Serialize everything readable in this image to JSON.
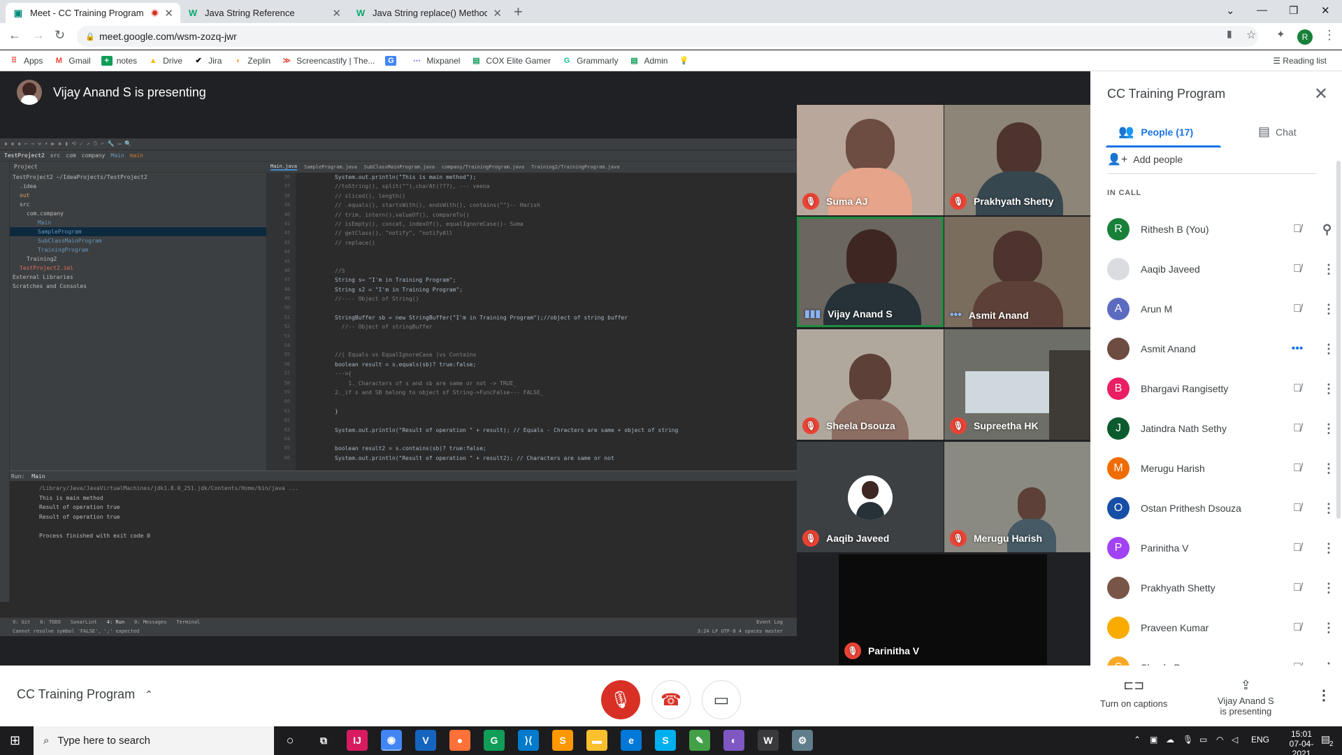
{
  "browser": {
    "tabs": [
      {
        "title": "Meet - CC Training Program"
      },
      {
        "title": "Java String Reference"
      },
      {
        "title": "Java String replace() Method"
      }
    ],
    "url": "meet.google.com/wsm-zozq-jwr",
    "bookmarks": [
      "Apps",
      "Gmail",
      "notes",
      "Drive",
      "Jira",
      "Zeplin",
      "Screencastify | The...",
      "",
      "Mixpanel",
      "COX Elite Gamer",
      "Grammarly",
      "Admin",
      ""
    ],
    "reading_list": "Reading list",
    "profile_letter": "R"
  },
  "meet": {
    "presenting_banner": "Vijay Anand S is presenting",
    "meeting_name": "CC Training Program",
    "tiles": [
      {
        "name": "Suma AJ",
        "muted": true
      },
      {
        "name": "Prakhyath Shetty",
        "muted": true
      },
      {
        "name": "Vijay Anand S",
        "muted": false
      },
      {
        "name": "Asmit Anand",
        "muted": false
      },
      {
        "name": "Sheela Dsouza",
        "muted": true
      },
      {
        "name": "Supreetha HK",
        "muted": true
      },
      {
        "name": "Aaqib Javeed",
        "muted": true
      },
      {
        "name": "Merugu Harish",
        "muted": true
      },
      {
        "name": "Parinitha V",
        "muted": true
      }
    ],
    "captions_label": "Turn on captions",
    "presenting_label_1": "Vijay Anand S",
    "presenting_label_2": "is presenting"
  },
  "side_panel": {
    "title": "CC Training Program",
    "people_tab": "People (17)",
    "chat_tab": "Chat",
    "add_people": "Add people",
    "in_call": "IN CALL",
    "people": [
      {
        "name": "Rithesh B (You)",
        "initial": "R",
        "color": "#188038"
      },
      {
        "name": "Aaqib Javeed",
        "initial": "",
        "color": "#dadce0"
      },
      {
        "name": "Arun M",
        "initial": "A",
        "color": "#5c6bc0"
      },
      {
        "name": "Asmit Anand",
        "initial": "",
        "color": "#6d4c41"
      },
      {
        "name": "Bhargavi Rangisetty",
        "initial": "B",
        "color": "#e91e63"
      },
      {
        "name": "Jatindra Nath Sethy",
        "initial": "J",
        "color": "#0b5b2e"
      },
      {
        "name": "Merugu Harish",
        "initial": "M",
        "color": "#ef6c00"
      },
      {
        "name": "Ostan Prithesh Dsouza",
        "initial": "O",
        "color": "#174ea6"
      },
      {
        "name": "Parinitha V",
        "initial": "P",
        "color": "#a142f4"
      },
      {
        "name": "Prakhyath Shetty",
        "initial": "",
        "color": "#795548"
      },
      {
        "name": "Praveen Kumar",
        "initial": "",
        "color": "#f9ab00"
      },
      {
        "name": "Sheela Dsouza",
        "initial": "S",
        "color": "#f9a825"
      }
    ]
  },
  "ide": {
    "breadcrumb": [
      "TestProject2",
      "src",
      "com",
      "company",
      "Main",
      "main"
    ],
    "project_label": "Project",
    "tree": [
      "TestProject2  ~/IdeaProjects/TestProject2",
      ".idea",
      "out",
      "src",
      "com.company",
      "Main",
      "SampleProgram",
      "SubClassMainProgram",
      "TrainingProgram",
      "Training2",
      "TestProject2.iml",
      "External Libraries",
      "Scratches and Consoles"
    ],
    "editor_tabs": [
      "Main.java",
      "SampleProgram.java",
      "SubClassMainProgram.java",
      "company/TrainingProgram.java",
      "Training2/TrainingProgram.java"
    ],
    "line_numbers": [
      "36",
      "37",
      "38",
      "39",
      "40",
      "41",
      "42",
      "43",
      "44",
      "45",
      "46",
      "47",
      "48",
      "49",
      "50",
      "51",
      "52",
      "53",
      "54",
      "55",
      "56",
      "57",
      "58",
      "59",
      "60",
      "61",
      "62",
      "63",
      "64",
      "65",
      "66"
    ],
    "code_lines": [
      "System.out.println(\"This is main method\");",
      "//toString(), split(\"\"),charAt(???), --- veena",
      "// sliced(), length()",
      "// .equals(), startsWith(), endsWith(), contains(\"\")-- Harish",
      "// trim, intern(),valueOf(), compareTo()",
      "// isEmpty(), concat, indexOf(), equalIgnoreCase()- Suma",
      "// getClass(), \"notify\", \"notifyAll",
      "// replace()",
      "",
      "",
      "//S",
      "String s= \"I'm in Training Program\";",
      "String s2 = \"I'm in Training Program\";",
      "//---- Object of String()",
      "",
      "StringBuffer sb = new StringBuffer(\"I'm in Training Program\");//object of string buffer",
      "  //-- Object of stringBuffer",
      "",
      "",
      "//( Equals vs EqualIgnoreCase )vs Contains",
      "boolean result = s.equals(sb)? true:false;",
      "--->{",
      "    1._Characters of s and sb are same or not -> TRUE_",
      "2._if s and SB belong to object of String->FuncFalse--- FALSE_",
      "",
      "}",
      "",
      "System.out.println(\"Result of operation \" + result); // Equals - Chracters are same + object of string",
      "",
      "boolean result2 = s.contains(sb)? true:false;",
      "System.out.println(\"Result of operation \" + result2); // Characters are same or not"
    ],
    "run_tab": "Main",
    "run_label": "Run:",
    "run_output": [
      "/Library/Java/JavaVirtualMachines/jdk1.8.0_251.jdk/Contents/Home/bin/java ...",
      "This is main method",
      "Result of operation true",
      "Result of operation true",
      "",
      "Process finished with exit code 0"
    ],
    "bottom_tabs": [
      "9: Git",
      "6: TODO",
      "SonarLint",
      "4: Run",
      "0: Messages",
      "Terminal"
    ],
    "event_log": "Event Log",
    "status_msg": "Cannot resolve symbol 'FALSE', ';' expected",
    "status_right": "3:24  LF  UTF-8  4 spaces  master"
  },
  "taskbar": {
    "search_placeholder": "Type here to search",
    "lang": "ENG",
    "time": "15:01",
    "date": "07-04-2021",
    "notif_count": "2"
  }
}
